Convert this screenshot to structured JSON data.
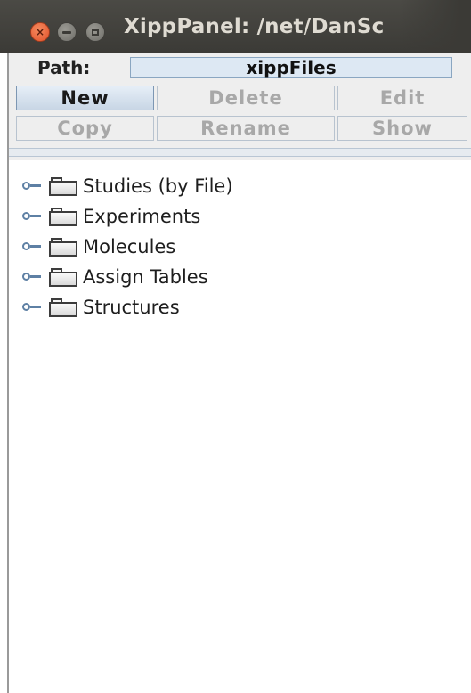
{
  "window": {
    "title": "XippPanel: /net/DanSc"
  },
  "path": {
    "label": "Path:",
    "value": "xippFiles"
  },
  "buttons": {
    "new": "New",
    "delete": "Delete",
    "edit": "Edit",
    "copy": "Copy",
    "rename": "Rename",
    "show": "Show"
  },
  "tree": {
    "items": [
      {
        "label": "Studies (by File)"
      },
      {
        "label": "Experiments"
      },
      {
        "label": "Molecules"
      },
      {
        "label": "Assign Tables"
      },
      {
        "label": "Structures"
      }
    ]
  },
  "colors": {
    "titlebar": "#3b3a36",
    "close_button": "#e2522b",
    "enabled_button": "#c8d6e5",
    "disabled_text": "#a8a8a8"
  }
}
